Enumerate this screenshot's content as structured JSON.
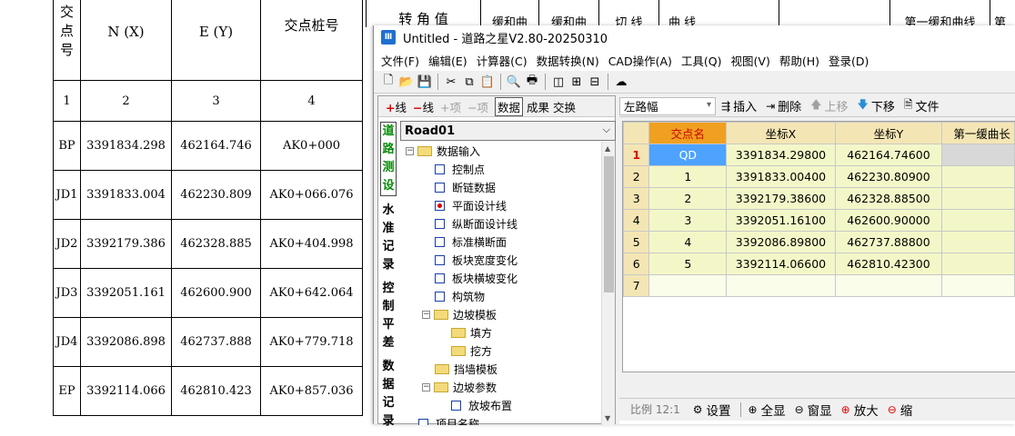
{
  "doc": {
    "header": [
      "交点号",
      "N (X)",
      "E (Y)",
      "交点桩号"
    ],
    "header_right": [
      "转 角 值",
      "缓和曲",
      "缓和曲",
      "切 线",
      "曲 线",
      "第一缓和曲线",
      "第"
    ],
    "index_row": [
      "1",
      "2",
      "3",
      "4"
    ],
    "rows": [
      [
        "BP",
        "3391834.298",
        "462164.746",
        "AK0+000"
      ],
      [
        "JD1",
        "3391833.004",
        "462230.809",
        "AK0+066.076"
      ],
      [
        "JD2",
        "3392179.386",
        "462328.885",
        "AK0+404.998"
      ],
      [
        "JD3",
        "3392051.161",
        "462600.900",
        "AK0+642.064"
      ],
      [
        "JD4",
        "3392086.898",
        "462737.888",
        "AK0+779.718"
      ],
      [
        "EP",
        "3392114.066",
        "462810.423",
        "AK0+857.036"
      ]
    ]
  },
  "window": {
    "title": "Untitled - 道路之星V2.80-20250310",
    "menu": [
      "文件(F)",
      "编辑(E)",
      "计算器(C)",
      "数据转换(N)",
      "CAD操作(A)",
      "工具(Q)",
      "视图(V)",
      "帮助(H)",
      "登录(D)"
    ]
  },
  "left": {
    "toolbar": {
      "add_line": "线",
      "del_line": "线",
      "add_item": "+项",
      "del_item": "−项",
      "tab_data": "数据",
      "tab_result": "成果",
      "tab_swap": "交换"
    },
    "project": "Road01",
    "vtabs": [
      "道路测设",
      "水准记录",
      "控制平差",
      "数据记录"
    ],
    "tree": [
      {
        "label": "数据输入",
        "type": "folder",
        "level": 0,
        "exp": "−"
      },
      {
        "label": "控制点",
        "type": "check",
        "level": 1
      },
      {
        "label": "断链数据",
        "type": "check",
        "level": 1
      },
      {
        "label": "平面设计线",
        "type": "check-on",
        "level": 1
      },
      {
        "label": "纵断面设计线",
        "type": "check",
        "level": 1
      },
      {
        "label": "标准横断面",
        "type": "check",
        "level": 1
      },
      {
        "label": "板块宽度变化",
        "type": "check",
        "level": 1
      },
      {
        "label": "板块横坡变化",
        "type": "check",
        "level": 1
      },
      {
        "label": "构筑物",
        "type": "check",
        "level": 1
      },
      {
        "label": "边坡模板",
        "type": "folder",
        "level": 1,
        "exp": "−"
      },
      {
        "label": "填方",
        "type": "folder",
        "level": 2
      },
      {
        "label": "挖方",
        "type": "folder",
        "level": 2
      },
      {
        "label": "挡墙模板",
        "type": "folder",
        "level": 1
      },
      {
        "label": "边坡参数",
        "type": "folder",
        "level": 1,
        "exp": "−"
      },
      {
        "label": "放坡布置",
        "type": "check",
        "level": 2
      },
      {
        "label": "项目名称",
        "type": "check",
        "level": 0
      }
    ]
  },
  "right": {
    "combo_value": "左路幅",
    "buttons": {
      "insert": "插入",
      "delete": "删除",
      "up": "上移",
      "down": "下移",
      "file": "文件"
    },
    "grid": {
      "columns": [
        "交点名",
        "坐标X",
        "坐标Y",
        "第一缓曲长"
      ],
      "rows": [
        {
          "n": "1",
          "name": "QD",
          "x": "3391834.29800",
          "y": "462164.74600"
        },
        {
          "n": "2",
          "name": "1",
          "x": "3391833.00400",
          "y": "462230.80900"
        },
        {
          "n": "3",
          "name": "2",
          "x": "3392179.38600",
          "y": "462328.88500"
        },
        {
          "n": "4",
          "name": "3",
          "x": "3392051.16100",
          "y": "462600.90000"
        },
        {
          "n": "5",
          "name": "4",
          "x": "3392086.89800",
          "y": "462737.88800"
        },
        {
          "n": "6",
          "name": "5",
          "x": "3392114.06600",
          "y": "462810.42300"
        },
        {
          "n": "7",
          "name": "",
          "x": "",
          "y": ""
        }
      ]
    },
    "bottom": {
      "scale": "比例 12:1",
      "settings": "设置",
      "fit_all": "全显",
      "window": "窗显",
      "zoom_in": "放大",
      "zoom_out": "缩"
    }
  }
}
